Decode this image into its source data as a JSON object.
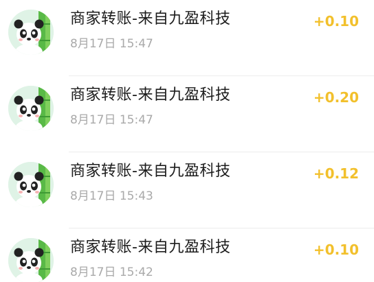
{
  "transactions": [
    {
      "title": "商家转账-来自九盈科技",
      "time": "8月17日 15:47",
      "amount": "+0.10",
      "avatar_icon": "panda-avatar-icon"
    },
    {
      "title": "商家转账-来自九盈科技",
      "time": "8月17日 15:47",
      "amount": "+0.20",
      "avatar_icon": "panda-avatar-icon"
    },
    {
      "title": "商家转账-来自九盈科技",
      "time": "8月17日 15:43",
      "amount": "+0.12",
      "avatar_icon": "panda-avatar-icon"
    },
    {
      "title": "商家转账-来自九盈科技",
      "time": "8月17日 15:42",
      "amount": "+0.10",
      "avatar_icon": "panda-avatar-icon"
    }
  ],
  "colors": {
    "amount": "#f2c02c",
    "title": "#1c1c1c",
    "time": "#a9a9a9",
    "divider": "#ececec"
  }
}
